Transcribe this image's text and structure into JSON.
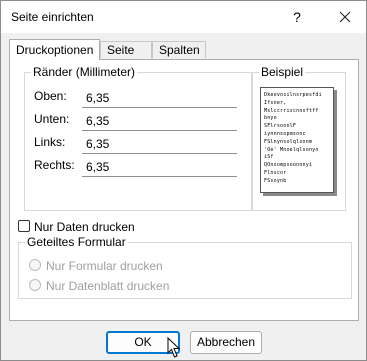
{
  "window": {
    "title": "Seite einrichten",
    "help_label": "?"
  },
  "tabs": [
    {
      "label": "Druckoptionen",
      "active": true
    },
    {
      "label": "Seite",
      "active": false
    },
    {
      "label": "Spalten",
      "active": false
    }
  ],
  "margins": {
    "group_label": "Ränder (Millimeter)",
    "rows": [
      {
        "label": "Oben:",
        "value": "6,35"
      },
      {
        "label": "Unten:",
        "value": "6,35"
      },
      {
        "label": "Links:",
        "value": "6,35"
      },
      {
        "label": "Rechts:",
        "value": "6,35"
      }
    ]
  },
  "example": {
    "group_label": "Beispiel",
    "preview_lines": [
      "Dkeovosilnsrpesfdi",
      "Ifsner,",
      "Mslccrriscnnsftff",
      "bnyo",
      "SFlrsoonlF",
      "iynnnsopmsonc",
      "FSlnynsolqlsonm",
      "'Oe' Mnoelqlsonyn",
      "iSf",
      "QOnsompsoonnnyi",
      "Flnscor",
      "FSsoynb"
    ]
  },
  "print_data_only": {
    "label": "Nur Daten drucken",
    "checked": false
  },
  "split_form": {
    "group_label": "Geteiltes Formular",
    "options": [
      {
        "label": "Nur Formular drucken",
        "enabled": false
      },
      {
        "label": "Nur Datenblatt drucken",
        "enabled": false
      }
    ]
  },
  "buttons": {
    "ok": "OK",
    "cancel": "Abbrechen"
  },
  "colors": {
    "accent": "#0078d4"
  }
}
